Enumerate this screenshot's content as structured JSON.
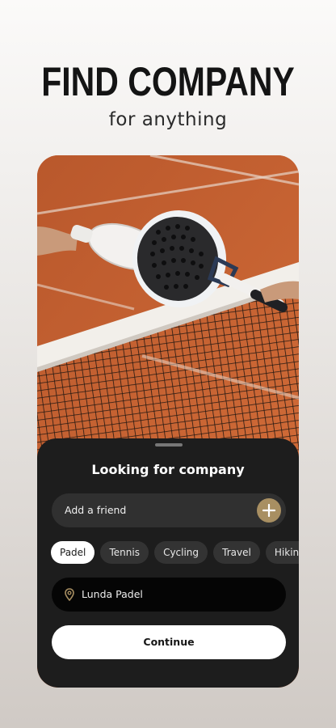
{
  "hero": {
    "title": "FIND COMPANY",
    "subtitle": "for anything"
  },
  "sheet": {
    "title": "Looking for company",
    "add_friend": {
      "placeholder": "Add a friend",
      "action_icon": "plus-icon"
    },
    "activities": [
      {
        "label": "Padel",
        "selected": true
      },
      {
        "label": "Tennis",
        "selected": false
      },
      {
        "label": "Cycling",
        "selected": false
      },
      {
        "label": "Travel",
        "selected": false
      },
      {
        "label": "Hiking",
        "selected": false
      }
    ],
    "location": {
      "icon": "location-pin-icon",
      "value": "Lunda Padel"
    },
    "continue_label": "Continue"
  },
  "colors": {
    "sheet_bg": "#1d1d1d",
    "accent_gold": "#a88f62",
    "court_clay": "#c8602f"
  }
}
